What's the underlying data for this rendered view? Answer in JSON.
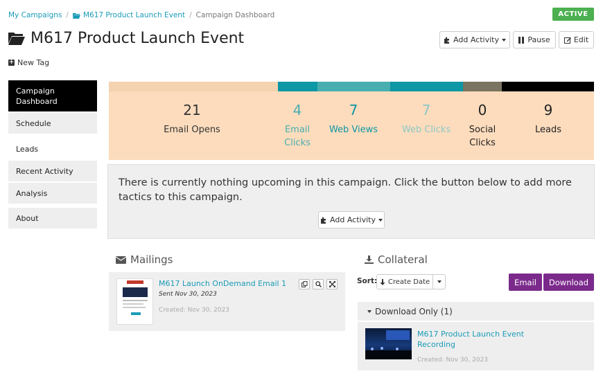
{
  "breadcrumb": {
    "item1": "My Campaigns",
    "item2": "M617 Product Launch Event",
    "current": "Campaign Dashboard"
  },
  "status": "ACTIVE",
  "title": "M617 Product Launch Event",
  "toolbar": {
    "add_activity": "Add Activity",
    "pause": "Pause",
    "edit": "Edit"
  },
  "new_tag": "New Tag",
  "sidebar": {
    "items": [
      {
        "label": "Campaign Dashboard"
      },
      {
        "label": "Schedule"
      },
      {
        "label": "Leads"
      },
      {
        "label": "Recent Activity"
      },
      {
        "label": "Analysis"
      },
      {
        "label": "About"
      }
    ]
  },
  "stats": {
    "bar_colors": [
      "#f5d2b0",
      "#0e97a4",
      "#48aeb0",
      "#0e97a4",
      "#7a7460",
      "#000000"
    ],
    "items": [
      {
        "value": "21",
        "label": "Email Opens",
        "color": "#333333"
      },
      {
        "value": "4",
        "label": "Email Clicks",
        "color": "#48aeb0"
      },
      {
        "value": "7",
        "label": "Web Views",
        "color": "#0e97a4"
      },
      {
        "value": "7",
        "label": "Web Clicks",
        "color": "#8cc8c6"
      },
      {
        "value": "0",
        "label": "Social Clicks",
        "color": "#222222"
      },
      {
        "value": "9",
        "label": "Leads",
        "color": "#222222"
      }
    ]
  },
  "upcoming": {
    "message": "There is currently nothing upcoming in this campaign. Click the button below to add more tactics to this campaign.",
    "button": "Add Activity"
  },
  "mailings": {
    "title": "Mailings",
    "items": [
      {
        "name": "M617 Launch OnDemand Email 1",
        "sent": "Sent Nov 30, 2023",
        "created": "Created: Nov 30, 2023"
      }
    ]
  },
  "collateral": {
    "title": "Collateral",
    "sort_label": "Sort:",
    "sort_value": "Create Date",
    "email_button": "Email",
    "download_button": "Download",
    "group_label": "Download Only (1)",
    "items": [
      {
        "name": "M617 Product Launch Event Recording",
        "created": "Created: Nov 30, 2023"
      }
    ]
  }
}
